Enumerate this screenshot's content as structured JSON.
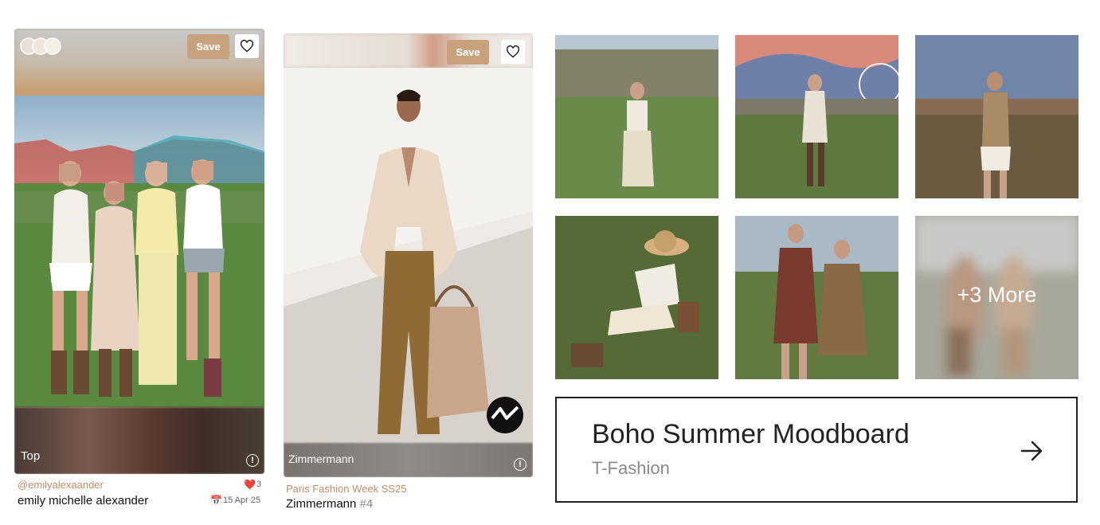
{
  "cards": [
    {
      "save_label": "Save",
      "overlay_label": "Top",
      "info_glyph": "!",
      "handle": "@emilyalexaander",
      "name": "emily michelle alexander",
      "likes": "3",
      "date": "15 Apr 25",
      "heart_emoji": "❤️",
      "calendar_emoji": "📅"
    },
    {
      "save_label": "Save",
      "overlay_label": "Zimmermann",
      "info_glyph": "!",
      "event": "Paris Fashion Week SS25",
      "brand": "Zimmermann",
      "look": "#4"
    }
  ],
  "moodboard": {
    "more_label": "+3 More",
    "title": "Boho Summer Moodboard",
    "subtitle": "T-Fashion"
  },
  "colors": {
    "accent": "#c7a27d",
    "handle_color": "#c48c66",
    "heart_red": "#e0282e"
  },
  "icons": [
    "toggle-icon",
    "heart-icon",
    "info-icon",
    "brand-logo-icon",
    "arrow-right-icon",
    "calendar-icon"
  ]
}
